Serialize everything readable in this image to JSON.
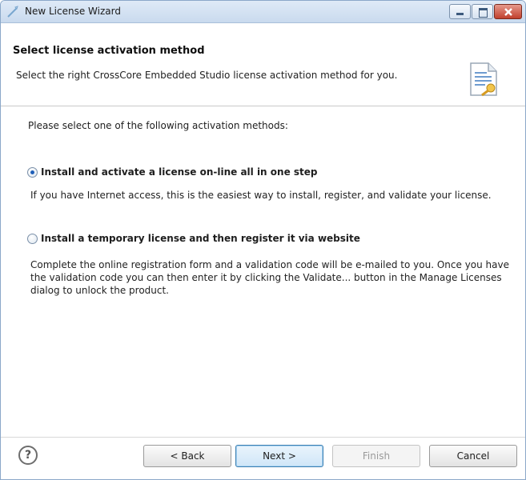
{
  "window": {
    "title": "New License Wizard",
    "icon": "wizard-icon"
  },
  "header": {
    "title": "Select license activation method",
    "description": "Select the right CrossCore Embedded Studio license activation method for you.",
    "icon": "license-document-icon"
  },
  "content": {
    "intro": "Please select one of the following activation methods:",
    "options": [
      {
        "label": "Install and activate a license on-line all in one step",
        "description": "If you have Internet access, this is the easiest way to install, register, and validate your license.",
        "checked": true
      },
      {
        "label": "Install a temporary license and then register it via website",
        "description": "Complete the online registration form and a validation code will be e-mailed to you. Once you have the validation code you can then enter it by clicking the Validate... button in the Manage Licenses dialog to unlock the product.",
        "checked": false
      }
    ]
  },
  "footer": {
    "help_label": "?",
    "back_label": "< Back",
    "next_label": "Next >",
    "finish_label": "Finish",
    "cancel_label": "Cancel"
  }
}
